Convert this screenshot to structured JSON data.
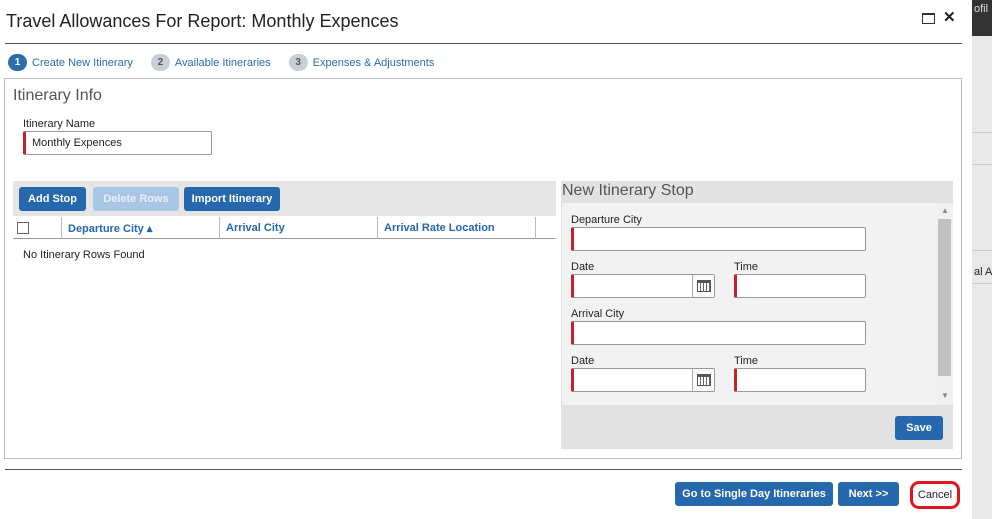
{
  "title": "Travel Allowances For Report: Monthly Expences",
  "backdrop": {
    "text_top": "ofil",
    "text_mid": "al Af"
  },
  "steps": [
    {
      "num": "1",
      "label": "Create New Itinerary"
    },
    {
      "num": "2",
      "label": "Available Itineraries"
    },
    {
      "num": "3",
      "label": "Expenses & Adjustments"
    }
  ],
  "itinerary_info": {
    "heading": "Itinerary Info",
    "name_label": "Itinerary Name",
    "name_value": "Monthly Expences"
  },
  "toolbar": {
    "add_stop": "Add Stop",
    "delete_rows": "Delete Rows",
    "import_itinerary": "Import Itinerary"
  },
  "grid": {
    "columns": [
      "Departure City ▴",
      "Arrival City",
      "Arrival Rate Location"
    ],
    "empty_message": "No Itinerary Rows Found"
  },
  "new_stop": {
    "heading": "New Itinerary Stop",
    "departure_city_label": "Departure City",
    "date_label_1": "Date",
    "time_label_1": "Time",
    "arrival_city_label": "Arrival City",
    "date_label_2": "Date",
    "time_label_2": "Time",
    "save": "Save"
  },
  "footer": {
    "single_day": "Go to Single Day Itineraries",
    "next": "Next >>",
    "cancel": "Cancel"
  },
  "colors": {
    "accent": "#2568ad",
    "required": "#c4202f",
    "highlight": "#e0151f"
  }
}
